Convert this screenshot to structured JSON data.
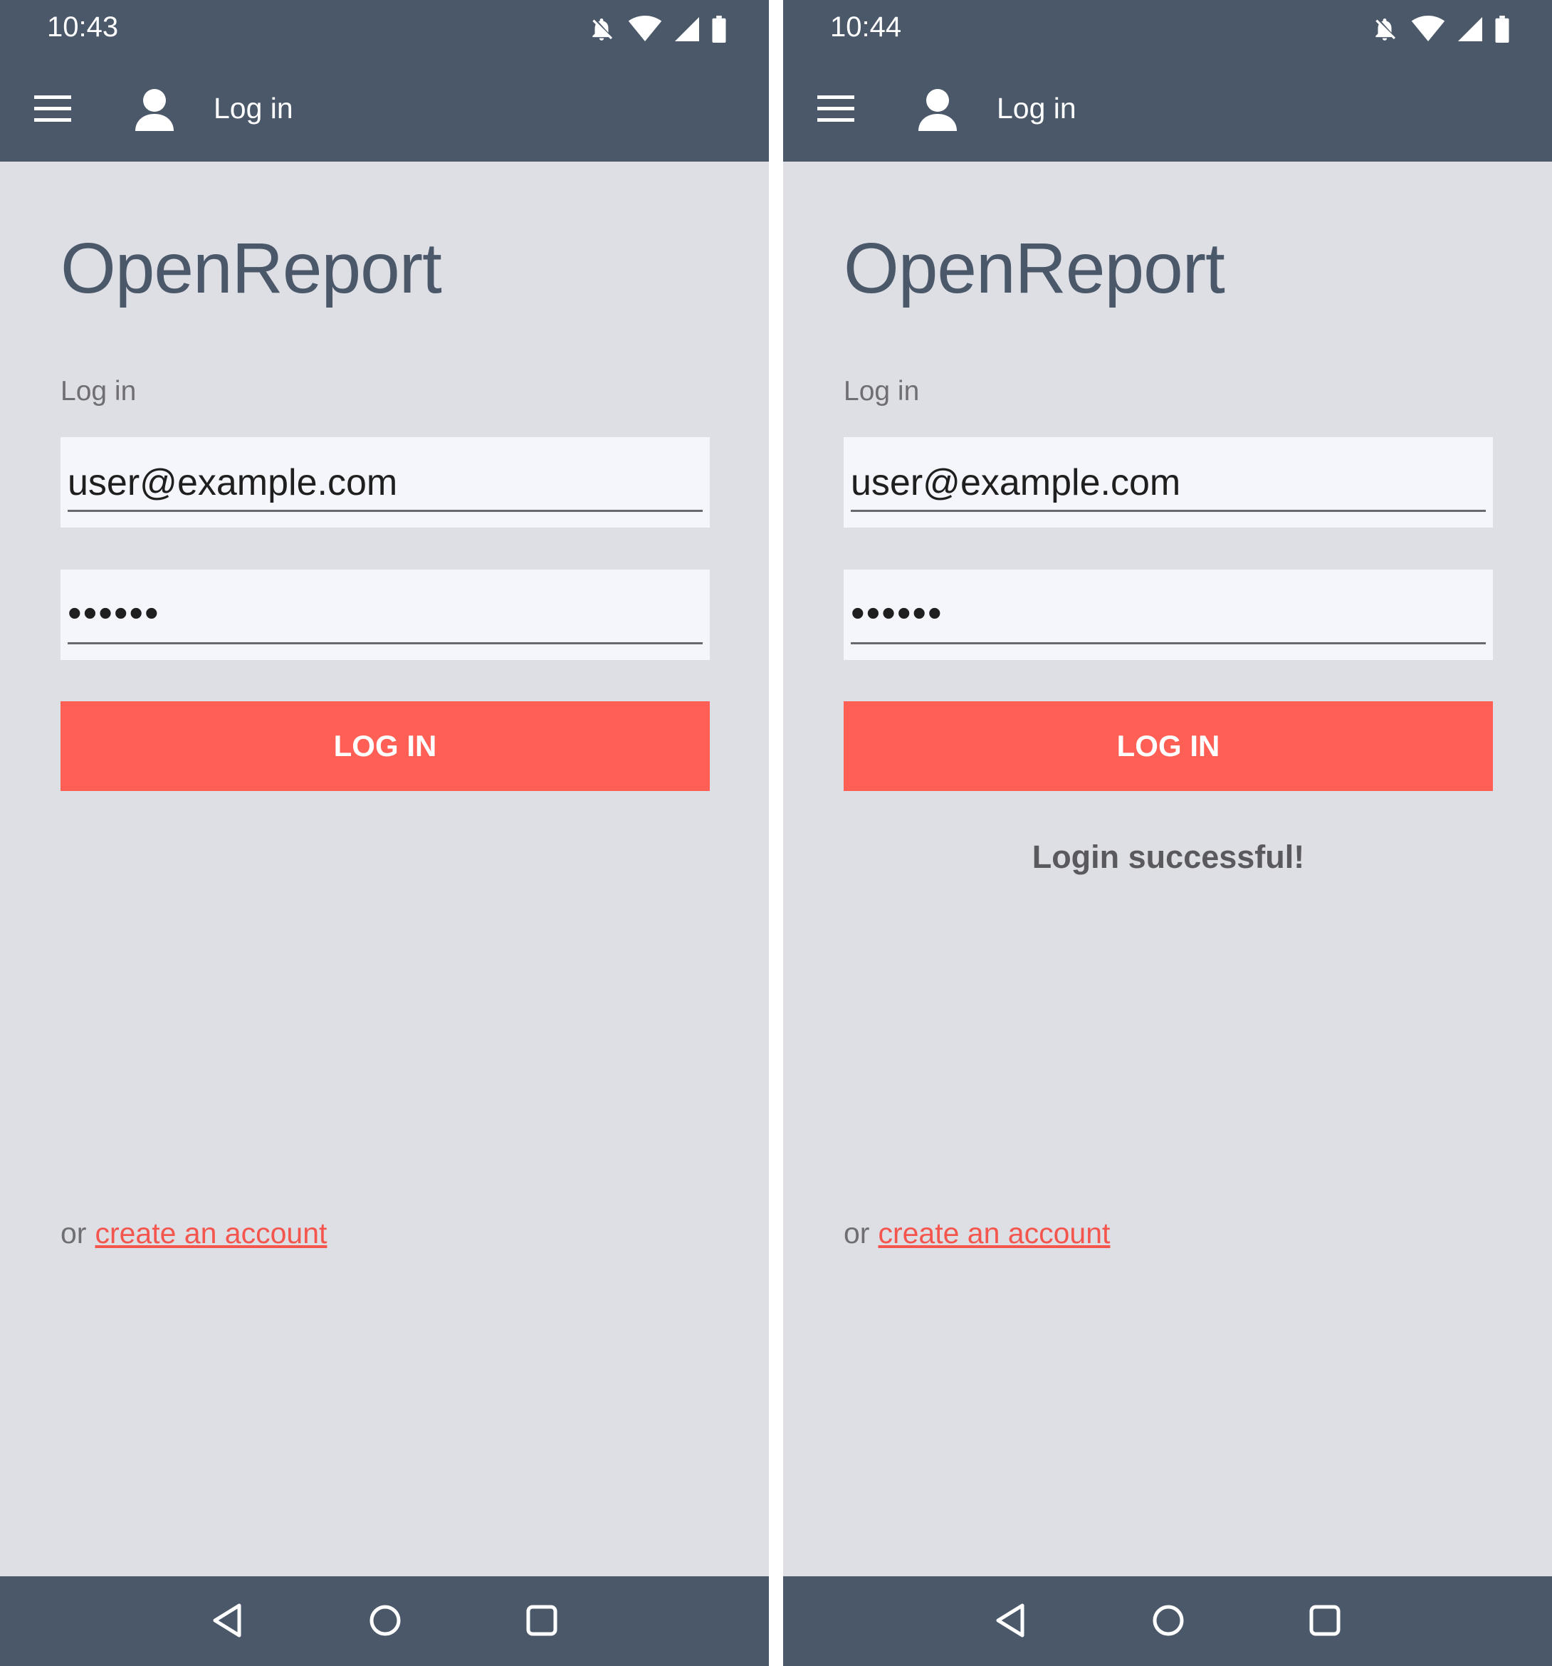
{
  "left_screen": {
    "status_time": "10:43",
    "appbar_title": "Log in",
    "app_title": "OpenReport",
    "section_label": "Log in",
    "email_value": "user@example.com",
    "password_value": "••••••",
    "login_button_label": "LOG IN",
    "alt_prefix": "or",
    "create_account_link": "create  an account"
  },
  "right_screen": {
    "status_time": "10:44",
    "appbar_title": "Log in",
    "app_title": "OpenReport",
    "section_label": "Log in",
    "email_value": "user@example.com",
    "password_value": "••••••",
    "login_button_label": "LOG IN",
    "success_message": "Login successful!",
    "alt_prefix": "or",
    "create_account_link": "create  an account"
  },
  "icons": {
    "status": [
      "bell-off-icon",
      "wifi-icon",
      "signal-icon",
      "battery-icon"
    ],
    "appbar": [
      "menu-icon",
      "user-icon"
    ],
    "navbar": [
      "back-icon",
      "home-icon",
      "recents-icon"
    ]
  },
  "colors": {
    "bar": "#4a5869",
    "background": "#dedee5",
    "accent": "#ff5f55",
    "field_bg": "#f5f6fb",
    "title_text": "#4a5869"
  }
}
